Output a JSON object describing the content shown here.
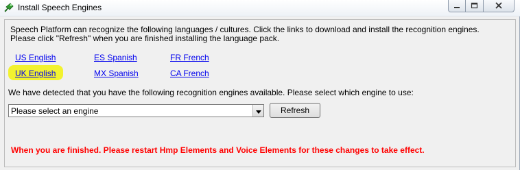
{
  "window": {
    "title": "Install Speech Engines",
    "icon": "speech-engine-app-icon",
    "controls": {
      "minimize": "minimize-icon",
      "maximize": "maximize-icon",
      "close": "close-icon"
    }
  },
  "intro": {
    "text": "Speech Platform can recognize the following languages / cultures. Click the links to download and install the recognition engines. Please click \"Refresh\" when  you are finished installing the language pack."
  },
  "links": {
    "us_english": "US English",
    "es_spanish": "ES Spanish",
    "fr_french": "FR French",
    "uk_english": "UK English",
    "mx_spanish": "MX Spanish",
    "ca_french": "CA French"
  },
  "highlight_color": "#f2f21a",
  "detect": {
    "text": "We have detected that you have the following recognition engines available. Please select which engine to use:"
  },
  "engine_select": {
    "selected": "Please select an engine"
  },
  "buttons": {
    "refresh": "Refresh"
  },
  "warning": {
    "text": "When you are finished. Please restart Hmp Elements and Voice Elements for these changes to take effect.",
    "color": "#ff0000"
  }
}
